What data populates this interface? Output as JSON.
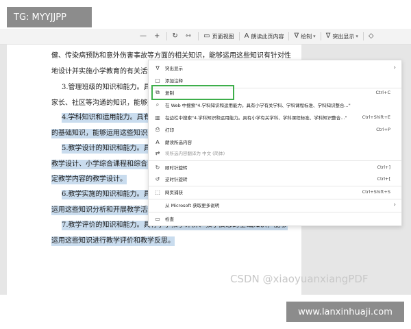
{
  "tag_top": "TG: MYYJJPP",
  "toolbar": {
    "items": [
      {
        "icon": "minus-icon",
        "glyph": "—",
        "label": ""
      },
      {
        "icon": "plus-icon",
        "glyph": "+",
        "label": ""
      },
      {
        "icon": "rotate-icon",
        "glyph": "↻",
        "label": ""
      },
      {
        "icon": "fit-page-icon",
        "glyph": "⇿",
        "label": ""
      },
      {
        "icon": "page-view-icon",
        "glyph": "▭",
        "label": "页面视图"
      },
      {
        "icon": "read-aloud-icon",
        "glyph": "A",
        "label": "朗读此页内容"
      },
      {
        "icon": "draw-icon",
        "glyph": "∇",
        "label": "绘制"
      },
      {
        "icon": "highlight-icon",
        "glyph": "∇",
        "label": "突出显示"
      },
      {
        "icon": "erase-icon",
        "glyph": "◇",
        "label": ""
      }
    ]
  },
  "document": {
    "lines": [
      {
        "text": "健、传染病预防和意外伤害事故等方面的相关知识，能够运用这些知识有针对性",
        "hl": false
      },
      {
        "text": "地设计并实施小学教育的有关活动。",
        "hl": false
      },
      {
        "text": "3.管理班级的知识和能力。具有小",
        "hl": false
      },
      {
        "text": "家长、社区等沟通的知识，能够运用",
        "hl": false
      },
      {
        "text": "4.学科知识和运用能力。具有小",
        "hl": true
      },
      {
        "text": "的基础知识，能够运用这些知识开展",
        "hl": true
      },
      {
        "text": "5.教学设计的知识和能力。具有小",
        "hl": true
      },
      {
        "text": "教学设计、小学综合课程和综合实践",
        "hl": true
      },
      {
        "text": "定教学内容的教学设计。",
        "hl": true
      },
      {
        "text": "6.教学实施的知识和能力。具有小",
        "hl": true
      },
      {
        "text": "运用这些知识分析和开展教学活动。",
        "hl": true
      },
      {
        "text": "7.教学评价的知识和能力。具有小学教学评价、教学反思的基础知识，能够",
        "hl": true
      },
      {
        "text": "运用这些知识进行教学评价和教学反思。",
        "hl": true
      }
    ]
  },
  "context_menu": {
    "items": [
      {
        "icon": "highlight-icon",
        "glyph": "∇",
        "label": "突出显示",
        "shortcut": "",
        "arrow": true,
        "disabled": false
      },
      {
        "icon": "comment-icon",
        "glyph": "▢",
        "label": "添加注释",
        "shortcut": "",
        "arrow": false,
        "disabled": false
      },
      {
        "icon": "copy-icon",
        "glyph": "⧉",
        "label": "复制",
        "shortcut": "Ctrl+C",
        "arrow": false,
        "disabled": false
      },
      {
        "icon": "web-search-icon",
        "glyph": "⌕",
        "label": "在 Web 中搜索\"4.学科知识和运用能力。具有小学有关学科、学科课程标准、学科知识整合...\"",
        "shortcut": "",
        "arrow": false,
        "disabled": false
      },
      {
        "icon": "sidebar-search-icon",
        "glyph": "▥",
        "label": "在边栏中搜索\"4.学科知识和运用能力。具有小学有关学科、学科课程标准、学科知识整合...\"",
        "shortcut": "Ctrl+Shift+E",
        "arrow": false,
        "disabled": false
      },
      {
        "icon": "print-icon",
        "glyph": "⎙",
        "label": "打印",
        "shortcut": "Ctrl+P",
        "arrow": false,
        "disabled": false
      },
      {
        "icon": "read-aloud-icon",
        "glyph": "A",
        "label": "朗读所选内容",
        "shortcut": "",
        "arrow": false,
        "disabled": false
      },
      {
        "icon": "translate-icon",
        "glyph": "⇄",
        "label": "将所选内容翻译为 中文 (简体)",
        "shortcut": "",
        "arrow": false,
        "disabled": true
      },
      {
        "icon": "rotate-clockwise-icon",
        "glyph": "↻",
        "label": "顺时针旋转",
        "shortcut": "Ctrl+]",
        "arrow": false,
        "disabled": false
      },
      {
        "icon": "rotate-counterclockwise-icon",
        "glyph": "↺",
        "label": "逆时针旋转",
        "shortcut": "Ctrl+[",
        "arrow": false,
        "disabled": false
      },
      {
        "icon": "web-capture-icon",
        "glyph": "⬚",
        "label": "网页捕获",
        "shortcut": "Ctrl+Shift+S",
        "arrow": false,
        "disabled": false
      },
      {
        "icon": "",
        "glyph": "",
        "label": "从 Microsoft 获取更多说明",
        "shortcut": "",
        "arrow": true,
        "disabled": false
      },
      {
        "icon": "inspect-icon",
        "glyph": "▭",
        "label": "检查",
        "shortcut": "",
        "arrow": false,
        "disabled": false
      }
    ]
  },
  "watermark_csdn": "CSDN @xiaoyuanxiangPDF",
  "watermark_site": "www.lanxinhuaji.com"
}
